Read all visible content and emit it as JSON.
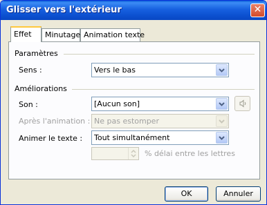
{
  "window": {
    "title": "Glisser vers l'extérieur",
    "close_glyph": "✕"
  },
  "tabs": [
    {
      "label": "Effet",
      "active": true
    },
    {
      "label": "Minutage",
      "active": false
    },
    {
      "label": "Animation texte",
      "active": false
    }
  ],
  "parametres": {
    "group_label": "Paramètres",
    "sens_label": "Sens :",
    "sens_value": "Vers le bas"
  },
  "ameliorations": {
    "group_label": "Améliorations",
    "son_label": "Son :",
    "son_value": "[Aucun son]",
    "apres_label": "Après l'animation :",
    "apres_value": "Ne pas estomper",
    "animer_label": "Animer le texte :",
    "animer_value": "Tout simultanément",
    "delai_value": "",
    "delai_label": "% délai entre les lettres"
  },
  "footer": {
    "ok_label": "OK",
    "cancel_label": "Annuler"
  },
  "colors": {
    "titlebar": "#0A5DD8",
    "dialog_bg": "#ECE9D8",
    "accent_tab": "#FFC83C"
  }
}
